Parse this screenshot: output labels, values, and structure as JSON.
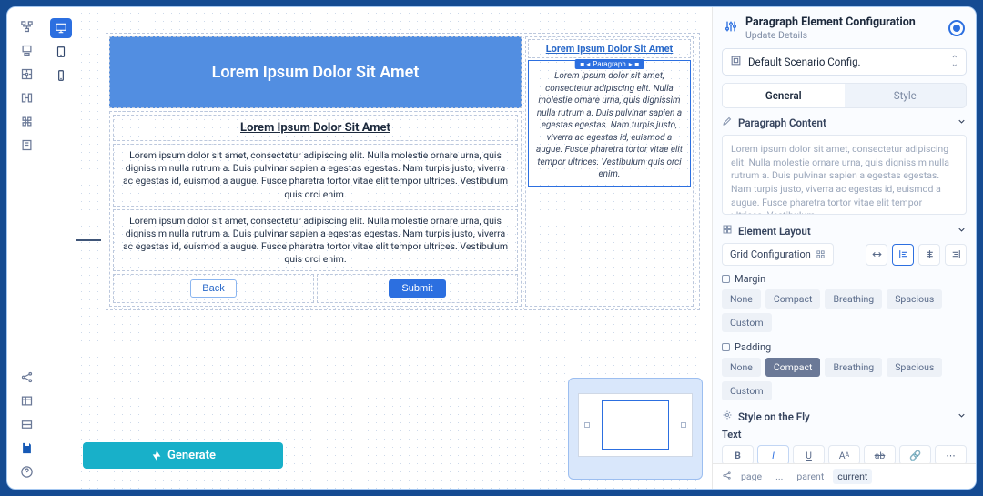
{
  "left_rail": {
    "top_icons": [
      "tree-icon",
      "layers-icon",
      "node-icon",
      "columns-icon",
      "puzzle-icon",
      "book-icon"
    ],
    "bottom_icons": [
      "share-icon",
      "table-icon",
      "db-icon",
      "save-icon",
      "help-icon"
    ]
  },
  "devices": [
    "desktop",
    "tablet",
    "phone"
  ],
  "canvas": {
    "hero_title": "Lorem Ipsum Dolor Sit Amet",
    "sub_heading": "Lorem Ipsum Dolor Sit Amet",
    "paragraph_a": "Lorem ipsum dolor sit amet, consectetur adipiscing elit. Nulla molestie ornare urna, quis dignissim nulla rutrum a. Duis pulvinar sapien a egestas egestas. Nam turpis justo, viverra ac egestas id, euismod a augue. Fusce pharetra tortor vitae elit tempor ultrices. Vestibulum quis orci enim.",
    "paragraph_b": "Lorem ipsum dolor sit amet, consectetur adipiscing elit. Nulla molestie ornare urna, quis dignissim nulla rutrum a. Duis pulvinar sapien a egestas egestas. Nam turpis justo, viverra ac egestas id, euismod a augue. Fusce pharetra tortor vitae elit tempor ultrices. Vestibulum quis orci enim.",
    "btn_back": "Back",
    "btn_submit": "Submit",
    "side_title": "Lorem Ipsum Dolor Sit Amet",
    "selected_tag": "Paragraph",
    "side_paragraph": "Lorem ipsum dolor sit amet, consectetur adipiscing elit. Nulla molestie ornare urna, quis dignissim nulla rutrum a. Duis pulvinar sapien a egestas egestas. Nam turpis justo, viverra ac egestas id, euismod a augue. Fusce pharetra tortor vitae elit tempor ultrices. Vestibulum quis orci enim.",
    "generate_label": "Generate"
  },
  "right_panel": {
    "title": "Paragraph Element Configuration",
    "subtitle": "Update Details",
    "scenario": "Default Scenario Config.",
    "tabs": {
      "general": "General",
      "style": "Style"
    },
    "sections": {
      "content": "Paragraph Content",
      "layout": "Element Layout",
      "styleonfly": "Style on the Fly"
    },
    "content_preview": "Lorem ipsum dolor sit amet, consectetur adipiscing elit. Nulla molestie ornare urna, quis dignissim nulla rutrum a. Duis pulvinar sapien a egestas egestas. Nam turpis justo, viverra ac egestas id, euismod a augue. Fusce pharetra tortor vitae elit tempor ultrices. Vestibulum",
    "grid_config": "Grid Configuration",
    "margin_label": "Margin",
    "padding_label": "Padding",
    "spacing_options": [
      "None",
      "Compact",
      "Breathing",
      "Spacious",
      "Custom"
    ],
    "margin_active": "",
    "padding_active": "Compact",
    "text_label": "Text",
    "breadcrumb": {
      "page": "page",
      "dots": "...",
      "parent": "parent",
      "current": "current"
    }
  }
}
